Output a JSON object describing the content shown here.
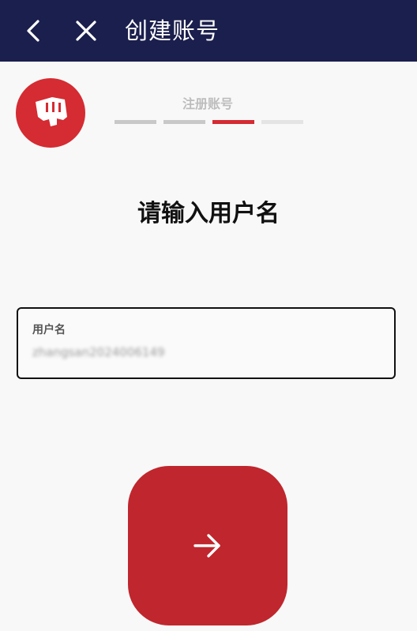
{
  "topbar": {
    "back_icon": "chevron-left-icon",
    "close_icon": "close-icon",
    "title": "创建账号"
  },
  "logo": {
    "icon": "riot-fist-icon",
    "color": "#d52b32"
  },
  "progress": {
    "label": "注册账号",
    "total_steps": 4,
    "current_step": 3
  },
  "main": {
    "heading": "请输入用户名"
  },
  "username_field": {
    "label": "用户名",
    "value": "zhangsan2024006149"
  },
  "next_button": {
    "icon": "arrow-right-icon",
    "color": "#c0262d"
  },
  "colors": {
    "header_bg": "#1b1f4d",
    "accent": "#d52b32",
    "background": "#f8f8f8"
  }
}
